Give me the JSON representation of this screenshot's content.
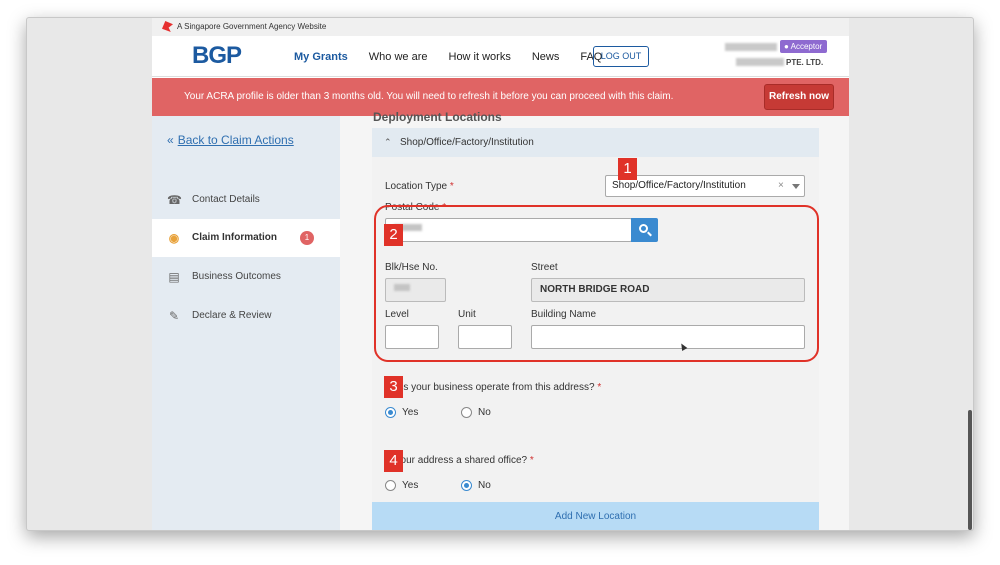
{
  "gov_banner": {
    "text": "A Singapore Government Agency Website"
  },
  "header": {
    "logo": "BGP",
    "nav": [
      "My Grants",
      "Who we are",
      "How it works",
      "News",
      "FAQ"
    ],
    "logout": "LOG OUT",
    "role": "Acceptor",
    "company_suffix": "PTE. LTD."
  },
  "alert": {
    "message": "Your ACRA profile is older than 3 months old. You will need to refresh it before you can proceed with this claim.",
    "button": "Refresh now"
  },
  "sidebar": {
    "back": "Back to Claim Actions",
    "items": [
      {
        "label": "Contact Details",
        "icon": "phone-icon"
      },
      {
        "label": "Claim Information",
        "icon": "piggy-bank-icon",
        "badge": "1"
      },
      {
        "label": "Business Outcomes",
        "icon": "chart-icon"
      },
      {
        "label": "Declare & Review",
        "icon": "pen-icon"
      }
    ]
  },
  "form": {
    "section_title": "Deployment Locations",
    "accordion_title": "Shop/Office/Factory/Institution",
    "location_type": {
      "label": "Location Type",
      "value": "Shop/Office/Factory/Institution",
      "clear": "×"
    },
    "postal_code": {
      "label": "Postal Code"
    },
    "blk": {
      "label": "Blk/Hse No."
    },
    "street": {
      "label": "Street",
      "value": "NORTH BRIDGE ROAD"
    },
    "level": {
      "label": "Level"
    },
    "unit": {
      "label": "Unit"
    },
    "building": {
      "label": "Building Name"
    },
    "q_operate": {
      "label": "Does your business operate from this address?",
      "yes": "Yes",
      "no": "No",
      "selected": "Yes"
    },
    "q_shared": {
      "label": "Is your address a shared office?",
      "yes": "Yes",
      "no": "No",
      "selected": "No"
    },
    "add_location": "Add New Location",
    "required_mark": "*"
  },
  "annotations": [
    "1",
    "2",
    "3",
    "4"
  ],
  "colors": {
    "brand": "#1c5aa0",
    "alert_bg": "#e06464",
    "highlight": "#e03228",
    "accent": "#3a8ad0"
  }
}
